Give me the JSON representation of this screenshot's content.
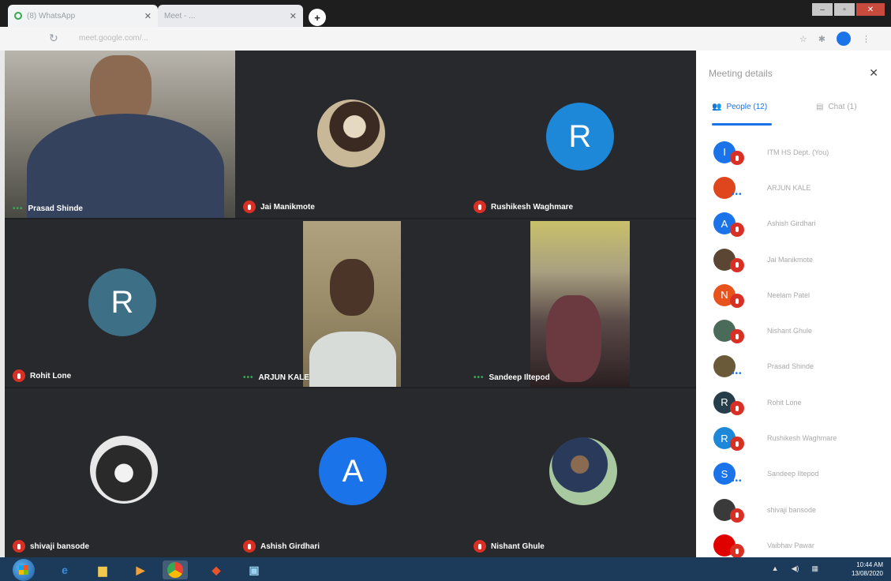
{
  "browser": {
    "tabs": [
      {
        "label": "(8) WhatsApp",
        "icon": "whatsapp-icon"
      },
      {
        "label": "Meet - ...",
        "icon": "meet-icon"
      }
    ],
    "new_tab_label": "+",
    "url": "meet.google.com/..."
  },
  "meet": {
    "tiles": [
      {
        "name": "Prasad Shinde",
        "status": "speaking",
        "kind": "video"
      },
      {
        "name": "Jai Manikmote",
        "status": "muted",
        "kind": "photo"
      },
      {
        "name": "Rushikesh Waghmare",
        "status": "muted",
        "kind": "letter",
        "letter": "R",
        "color": "#1e88d8"
      },
      {
        "name": "Rohit Lone",
        "status": "muted",
        "kind": "letter",
        "letter": "R",
        "color": "#3d6f86"
      },
      {
        "name": "ARJUN KALE",
        "status": "speaking",
        "kind": "video"
      },
      {
        "name": "Sandeep Iltepod",
        "status": "speaking",
        "kind": "video"
      },
      {
        "name": "shivaji bansode",
        "status": "muted",
        "kind": "photo"
      },
      {
        "name": "Ashish Girdhari",
        "status": "muted",
        "kind": "letter",
        "letter": "A",
        "color": "#1a73e8"
      },
      {
        "name": "Nishant Ghule",
        "status": "muted",
        "kind": "photo"
      }
    ]
  },
  "panel": {
    "title": "Meeting details",
    "tabs": {
      "people": "People (12)",
      "chat": "Chat (1)"
    },
    "people": [
      {
        "name": "ITM HS Dept. (You)",
        "letter": "I",
        "color": "#1a73e8",
        "status": "muted"
      },
      {
        "name": "ARJUN KALE",
        "letter": "",
        "color": "#e0461e",
        "status": "speaking"
      },
      {
        "name": "Ashish Girdhari",
        "letter": "A",
        "color": "#1a73e8",
        "status": "muted"
      },
      {
        "name": "Jai Manikmote",
        "letter": "",
        "color": "#5a4632",
        "status": "muted"
      },
      {
        "name": "Neelam Patel",
        "letter": "N",
        "color": "#e8531d",
        "status": "muted"
      },
      {
        "name": "Nishant Ghule",
        "letter": "",
        "color": "#4a6a5a",
        "status": "muted"
      },
      {
        "name": "Prasad Shinde",
        "letter": "",
        "color": "#6b5a3a",
        "status": "speaking"
      },
      {
        "name": "Rohit Lone",
        "letter": "R",
        "color": "#263e4a",
        "status": "muted"
      },
      {
        "name": "Rushikesh Waghmare",
        "letter": "R",
        "color": "#1e88d8",
        "status": "muted"
      },
      {
        "name": "Sandeep Iltepod",
        "letter": "S",
        "color": "#1a73e8",
        "status": "speaking"
      },
      {
        "name": "shivaji bansode",
        "letter": "",
        "color": "#3a3a3a",
        "status": "muted"
      },
      {
        "name": "Vaibhav Pawar",
        "letter": "",
        "color": "#e00000",
        "status": "muted"
      }
    ]
  },
  "taskbar": {
    "apps": [
      "ie-icon",
      "folder-icon",
      "media-player-icon",
      "chrome-icon",
      "cc-icon",
      "network-app-icon"
    ],
    "time": "10:44 AM",
    "date": "13/08/2020"
  }
}
